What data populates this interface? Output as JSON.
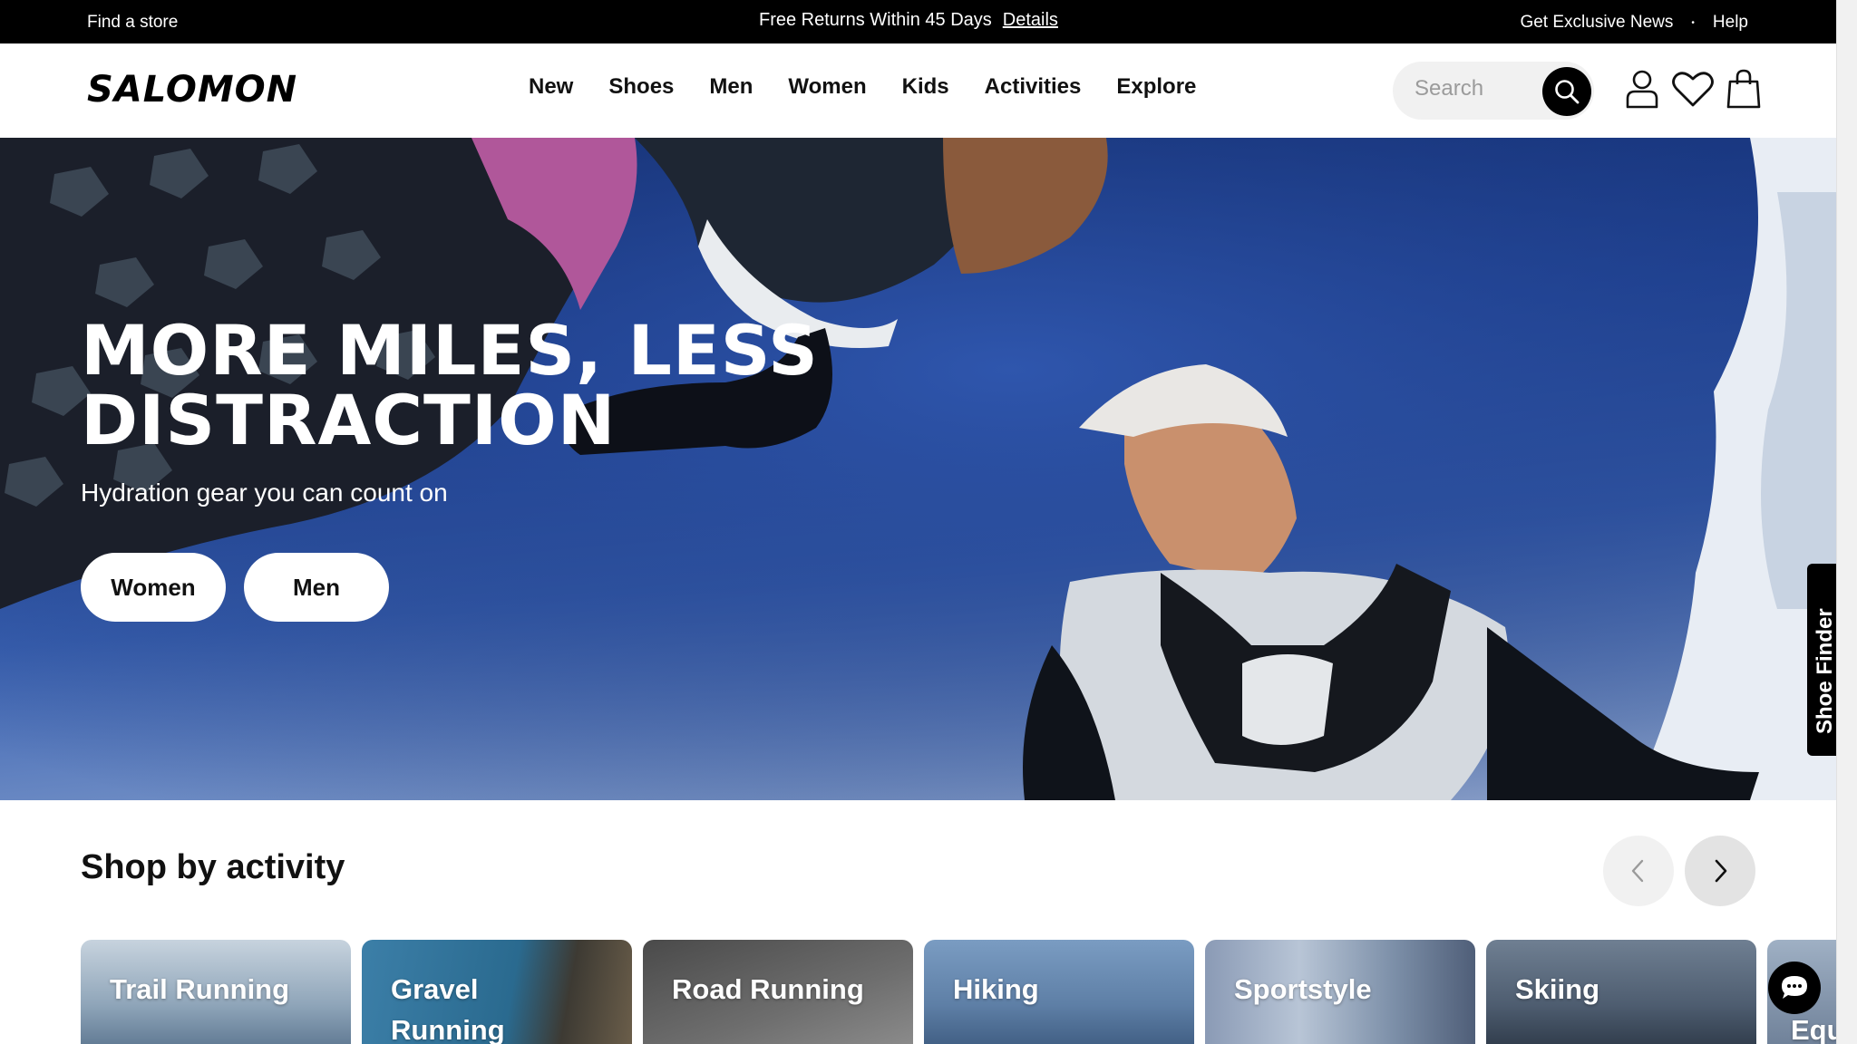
{
  "promo_bar": {
    "find_store": "Find a store",
    "returns": "Free Returns Within 45 Days",
    "details_link": "Details",
    "exclusive_news": "Get Exclusive News",
    "help": "Help"
  },
  "header": {
    "brand": "SALOMON",
    "nav": [
      "New",
      "Shoes",
      "Men",
      "Women",
      "Kids",
      "Activities",
      "Explore"
    ],
    "search_placeholder": "Search"
  },
  "hero": {
    "title_line1": "MORE MILES, LESS",
    "title_line2": "DISTRACTION",
    "subtitle": "Hydration gear you can count on",
    "cta_women": "Women",
    "cta_men": "Men",
    "shoe_finder": "Shoe Finder"
  },
  "activity": {
    "title": "Shop by activity",
    "cards": [
      {
        "label": "Trail Running"
      },
      {
        "label": "Gravel Running"
      },
      {
        "label": "Road Running"
      },
      {
        "label": "Hiking"
      },
      {
        "label": "Sportstyle"
      },
      {
        "label": "Skiing"
      },
      {
        "label": "Equ"
      }
    ]
  },
  "icons": {
    "search": "search-icon",
    "account": "user-icon",
    "wishlist": "heart-icon",
    "bag": "bag-icon",
    "prev": "chevron-left-icon",
    "next": "chevron-right-icon",
    "chat": "chat-icon"
  },
  "colors": {
    "promo_bg": "#000000",
    "accent": "#000000",
    "search_bg": "#f1f1f1"
  }
}
